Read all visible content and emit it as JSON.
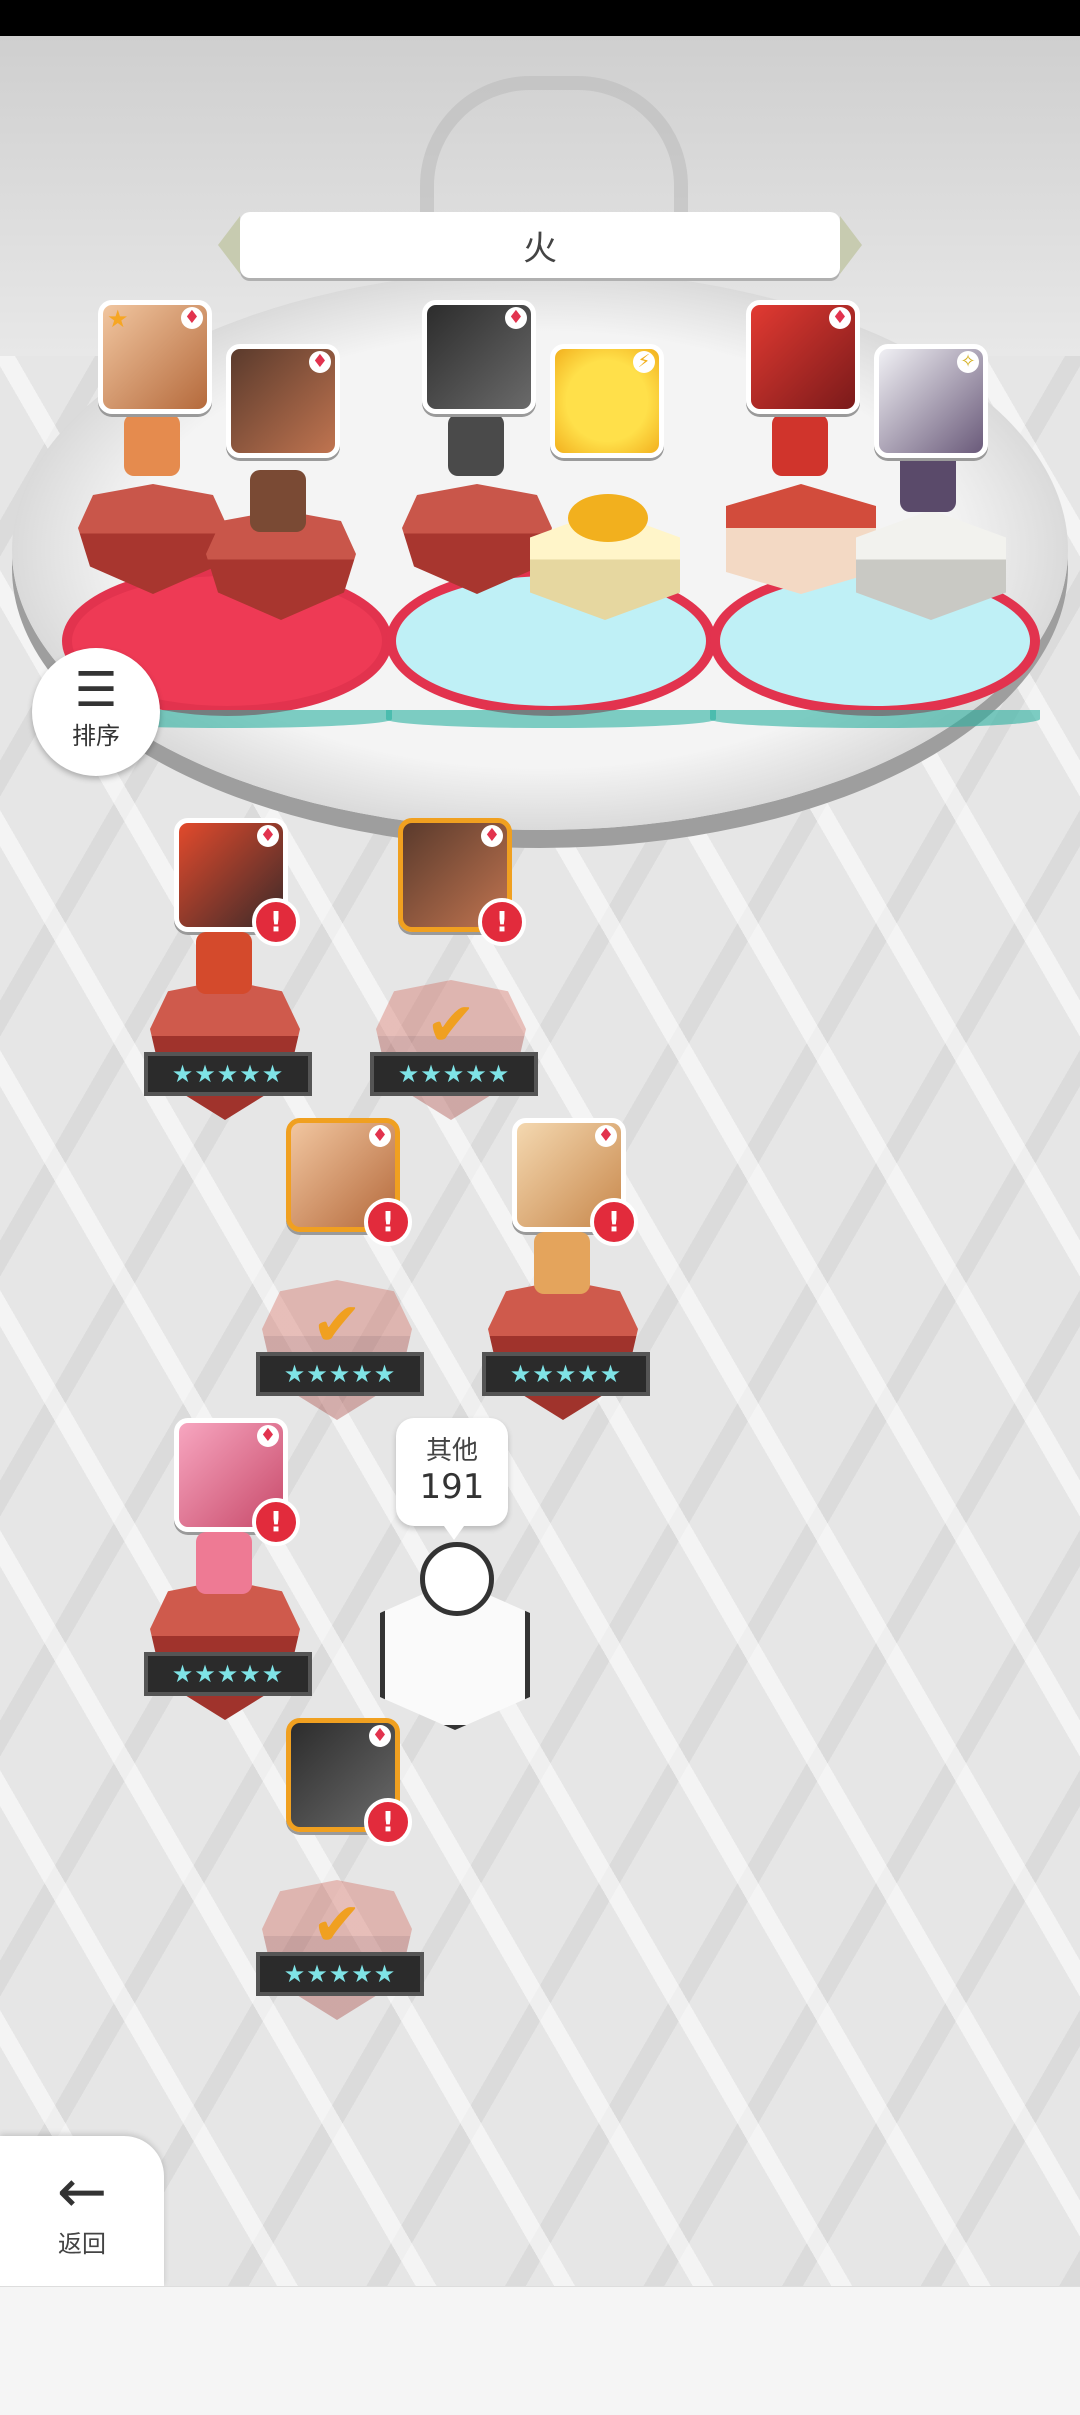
{
  "header": {
    "element_label": "火"
  },
  "sort_button": {
    "icon": "sort-icon",
    "label": "排序"
  },
  "team_slots": [
    {
      "card_suit": "♦",
      "star_badge": "★"
    },
    {
      "card_suit": "♦"
    },
    {
      "card_suit": "♦"
    },
    {
      "card_suit": "⚡"
    },
    {
      "card_suit": "♦"
    },
    {
      "card_suit": "✧"
    }
  ],
  "roster": [
    {
      "stars": "★★★★★",
      "alert": "!",
      "in_team": false,
      "card_suit": "♦"
    },
    {
      "stars": "★★★★★",
      "alert": "!",
      "in_team": true,
      "card_suit": "♦"
    },
    {
      "stars": "★★★★★",
      "alert": "!",
      "in_team": true,
      "card_suit": "♦"
    },
    {
      "stars": "★★★★★",
      "alert": "!",
      "in_team": false,
      "card_suit": "♦"
    },
    {
      "stars": "★★★★★",
      "alert": "!",
      "in_team": false,
      "card_suit": "♦"
    },
    {
      "stars": "★★★★★",
      "alert": "!",
      "in_team": true,
      "card_suit": "♦"
    }
  ],
  "other": {
    "label": "其他",
    "count": "191"
  },
  "back_button": {
    "icon": "back-arrow-icon",
    "label": "返回"
  },
  "colors": {
    "accent_red": "#e2334e",
    "selected_border": "#f0a020",
    "check": "#f0a020",
    "star": "#7fe3e6"
  }
}
